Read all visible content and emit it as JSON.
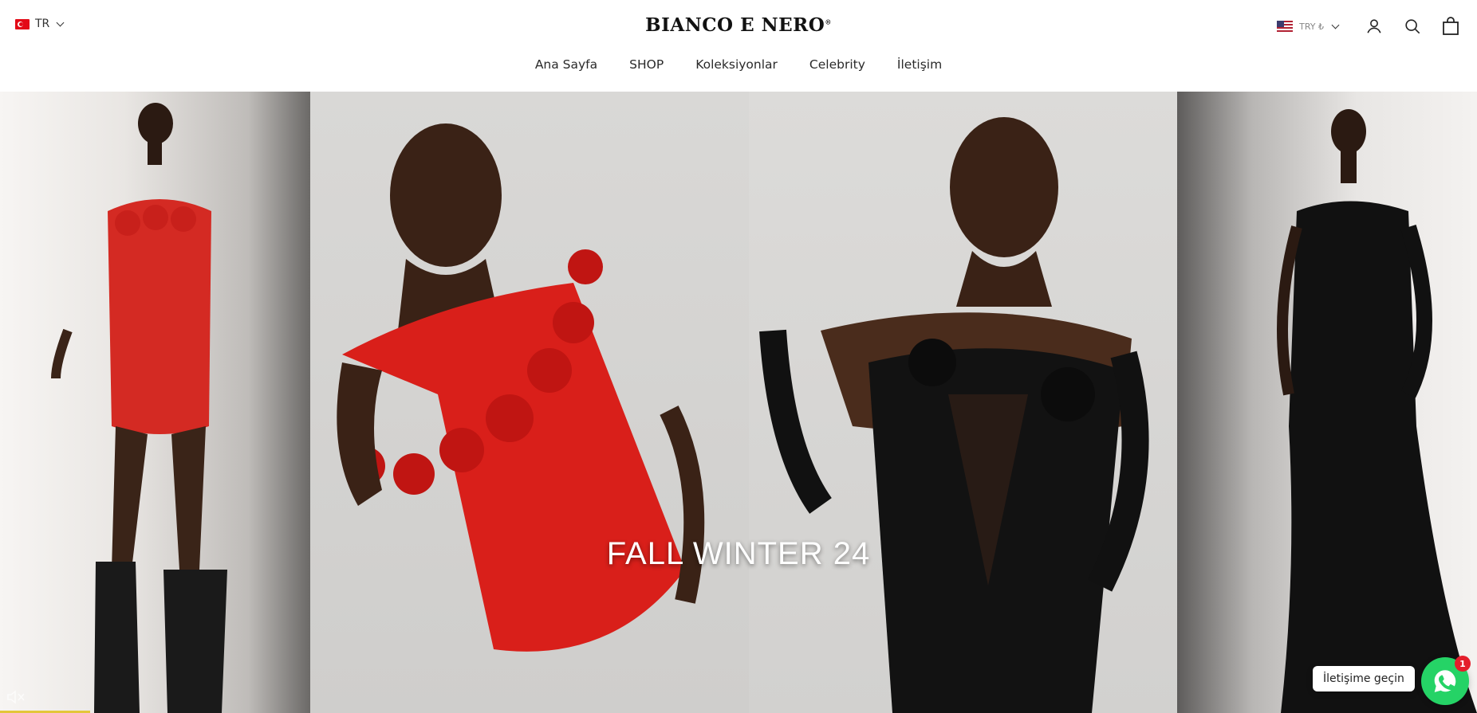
{
  "header": {
    "language": {
      "code": "TR",
      "flag": "turkey-flag"
    },
    "logo": "BIANCO E NERO",
    "logo_mark": "®",
    "currency": {
      "label": "TRY ₺",
      "flag": "us-flag"
    },
    "nav": [
      {
        "label": "Ana Sayfa"
      },
      {
        "label": "SHOP"
      },
      {
        "label": "Koleksiyonlar"
      },
      {
        "label": "Celebrity"
      },
      {
        "label": "İletişim"
      }
    ]
  },
  "hero": {
    "title": "FALL WINTER 24",
    "panels": [
      "red-mini-dress-boots",
      "red-rose-off-shoulder-dress",
      "black-velvet-feather-corset",
      "black-velvet-gown"
    ]
  },
  "widgets": {
    "contact_label": "İletişime geçin",
    "whatsapp_badge": "1",
    "accent": "#25d366"
  }
}
